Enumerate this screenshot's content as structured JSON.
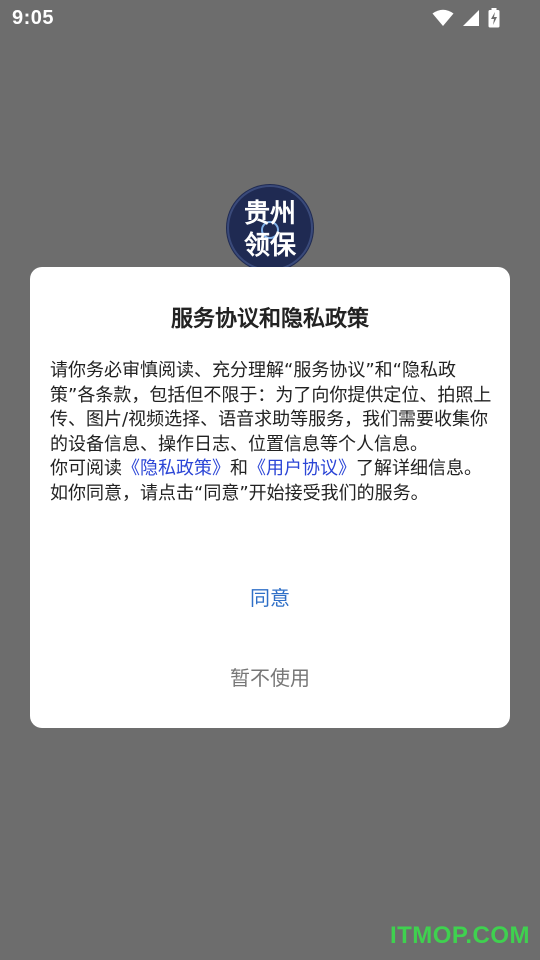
{
  "status_bar": {
    "time": "9:05",
    "icons": [
      "wifi-icon",
      "cellular-signal-icon",
      "battery-charging-icon"
    ]
  },
  "logo": {
    "line1": "贵州",
    "line2": "领保",
    "background": "#1f2a52"
  },
  "dialog": {
    "title": "服务协议和隐私政策",
    "body_part1": "请你务必审慎阅读、充分理解“服务协议”和“隐私政策”各条款，包括但不限于：为了向你提供定位、拍照上传、图片/视频选择、语音求助等服务，我们需要收集你的设备信息、操作日志、位置信息等个人信息。",
    "body_part2_prefix": "你可阅读",
    "privacy_link": "《隐私政策》",
    "connector": "和",
    "user_agreement_link": "《用户协议》",
    "body_part2_suffix": "了解详细信息。如你同意，请点击“同意”开始接受我们的服务。",
    "agree_label": "同意",
    "decline_label": "暂不使用"
  },
  "colors": {
    "backdrop": "#6d6d6d",
    "link": "#2b45d6",
    "agree": "#2f6fc7",
    "decline": "#777777"
  },
  "watermark": "ITMOP.COM"
}
